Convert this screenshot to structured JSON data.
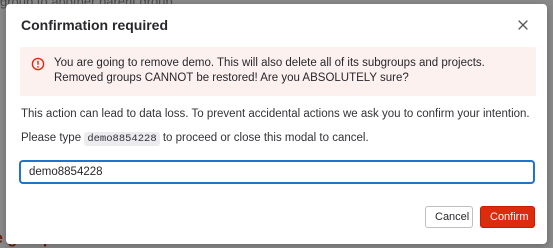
{
  "background": {
    "top_text": "group to another parent group.",
    "bottom_text": "e group"
  },
  "modal": {
    "title": "Confirmation required",
    "close_label": "×",
    "alert": {
      "icon": "error-circle-icon",
      "color": "#dd2b0e",
      "text": "You are going to remove demo. This will also delete all of its subgroups and projects. Removed groups CANNOT be restored! Are you ABSOLUTELY sure?"
    },
    "warning_text": "This action can lead to data loss. To prevent accidental actions we ask you to confirm your intention.",
    "instruction_prefix": "Please type",
    "instruction_code": "demo8854228",
    "instruction_suffix": "to proceed or close this modal to cancel.",
    "input": {
      "value": "demo8854228"
    },
    "buttons": {
      "cancel_label": "Cancel",
      "confirm_label": "Confirm"
    }
  },
  "colors": {
    "danger": "#dd2b0e",
    "focus": "#1f75cb",
    "alert_bg": "#fcf1ef"
  }
}
